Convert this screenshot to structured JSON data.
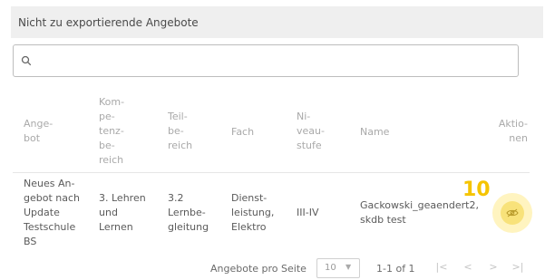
{
  "panel": {
    "title": "Nicht zu exportierende Angebote"
  },
  "search": {
    "placeholder": "",
    "value": "",
    "icon": "search-icon"
  },
  "table": {
    "headers": {
      "angebot": [
        "Ange-",
        "bot"
      ],
      "kompetenzbereich": [
        "Kom-",
        "pe-",
        "tenz-",
        "be-",
        "reich"
      ],
      "teilbereich": [
        "Teil-",
        "be-",
        "reich"
      ],
      "fach": [
        "Fach"
      ],
      "niveaustufe": [
        "Ni-",
        "veau-",
        "stufe"
      ],
      "name": [
        "Name"
      ],
      "aktionen": [
        "Aktio-",
        "nen"
      ]
    },
    "rows": [
      {
        "angebot": [
          "Neues An-",
          "gebot nach",
          "Update",
          "Testschule",
          "BS"
        ],
        "kompetenzbereich": [
          "3. Lehren",
          "und",
          "Lernen"
        ],
        "teilbereich": [
          "3.2",
          "Lernbe-",
          "gleitung"
        ],
        "fach": [
          "Dienst-",
          "leistung,",
          "Elektro"
        ],
        "niveaustufe": [
          "III-IV"
        ],
        "name": [
          "Gackowski_geaendert2,",
          "skdb test"
        ],
        "action_icon": "eye-off-icon"
      }
    ]
  },
  "annotation": {
    "badge_number": "10",
    "color": "#f5c400"
  },
  "footer": {
    "per_page_label": "Angebote pro Seite",
    "per_page_value": "10",
    "range": "1-1 of 1",
    "first_icon": "first-page-icon",
    "prev_icon": "prev-page-icon",
    "next_icon": "next-page-icon",
    "last_icon": "last-page-icon"
  }
}
